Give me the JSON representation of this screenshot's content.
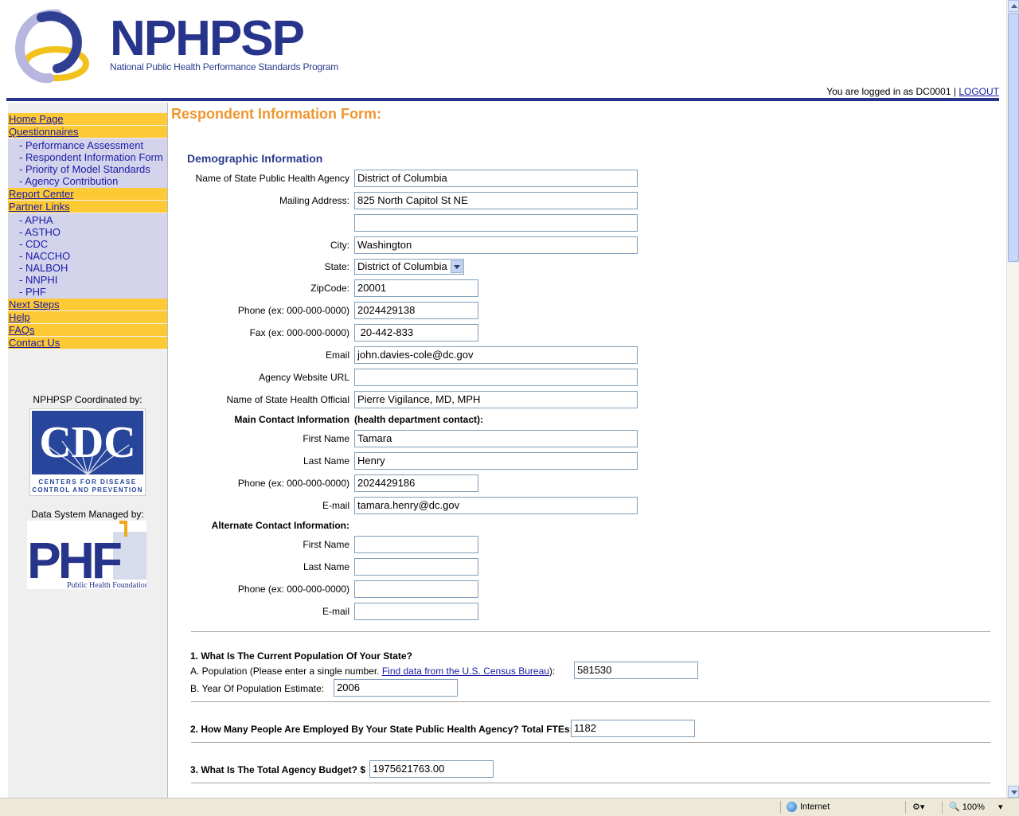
{
  "header": {
    "brand": "NPHPSP",
    "brand_subtitle": "National Public Health Performance Standards Program",
    "login_prefix": "You are logged in as DC0001 |",
    "logout_label": "LOGOUT",
    "brand_colors": {
      "navy": "#27348b",
      "gold": "#fdc935",
      "orange": "#f0962e"
    }
  },
  "sidebar": {
    "home": "Home Page",
    "questionnaires": "Questionnaires",
    "questionnaire_items": [
      "Performance Assessment",
      "Respondent Information Form",
      "Priority of Model Standards",
      "Agency Contribution"
    ],
    "report_center": "Report Center",
    "partner_links": "Partner Links",
    "partner_items": [
      "APHA",
      "ASTHO",
      "CDC",
      "NACCHO",
      "NALBOH",
      "NNPHI",
      "PHF"
    ],
    "next_steps": "Next Steps",
    "help": "Help",
    "faqs": "FAQs",
    "contact_us": "Contact Us",
    "coordinated_by": "NPHPSP Coordinated by:",
    "cdc_logo_text": "CDC",
    "cdc_logo_line1": "CENTERS FOR DISEASE",
    "cdc_logo_line2": "CONTROL AND PREVENTION",
    "managed_by": "Data System Managed by:",
    "phf_logo_text": "PHF",
    "phf_logo_caption": "Public Health Foundation"
  },
  "main": {
    "title": "Respondent Information Form:",
    "demographic_heading": "Demographic Information",
    "agency_name_label": "Name of State Public Health Agency",
    "agency_name_value": "District of Columbia",
    "mailing_label": "Mailing Address:",
    "mailing_value1": "825 North Capitol St NE",
    "mailing_value2": "",
    "city_label": "City:",
    "city_value": "Washington",
    "state_label": "State:",
    "state_value": "District of Columbia",
    "zip_label": "ZipCode:",
    "zip_value": "20001",
    "phone_label": "Phone (ex: 000-000-0000)",
    "phone_value": "2024429138",
    "fax_label": "Fax (ex: 000-000-0000)",
    "fax_value": " 20-442-833",
    "email_label": "Email",
    "email_value": "john.davies-cole@dc.gov",
    "website_label": "Agency Website URL",
    "website_value": "",
    "official_label": "Name of State Health Official",
    "official_value": "Pierre Vigilance, MD, MPH",
    "main_contact_label": "Main Contact Information",
    "main_contact_note": "(health department contact):",
    "first_name_label": "First Name",
    "main_first_value": "Tamara",
    "last_name_label": "Last Name",
    "main_last_value": "Henry",
    "contact_phone_label": "Phone (ex: 000-000-0000)",
    "main_phone_value": "2024429186",
    "email2_label": "E-mail",
    "main_email_value": "tamara.henry@dc.gov",
    "alt_contact_label": "Alternate Contact Information:",
    "alt_first_value": "",
    "alt_last_value": "",
    "alt_phone_value": "",
    "alt_email_value": "",
    "q1_title": "1. What Is The Current Population Of Your State?",
    "q1a_prefix": "A. Population (Please enter a single number.",
    "q1a_link": "Find data from the U.S. Census Bureau",
    "q1a_suffix": "):",
    "q1a_value": "581530",
    "q1b_label": "B. Year Of Population Estimate:",
    "q1b_value": "2006",
    "q2_title": "2. How Many People Are Employed By Your State Public Health Agency? Total FTEs:",
    "q2_value": "1182",
    "q3_title": "3. What Is The Total Agency Budget? $",
    "q3_value": "1975621763.00"
  },
  "statusbar": {
    "zone": "Internet",
    "zoom": "100%"
  }
}
